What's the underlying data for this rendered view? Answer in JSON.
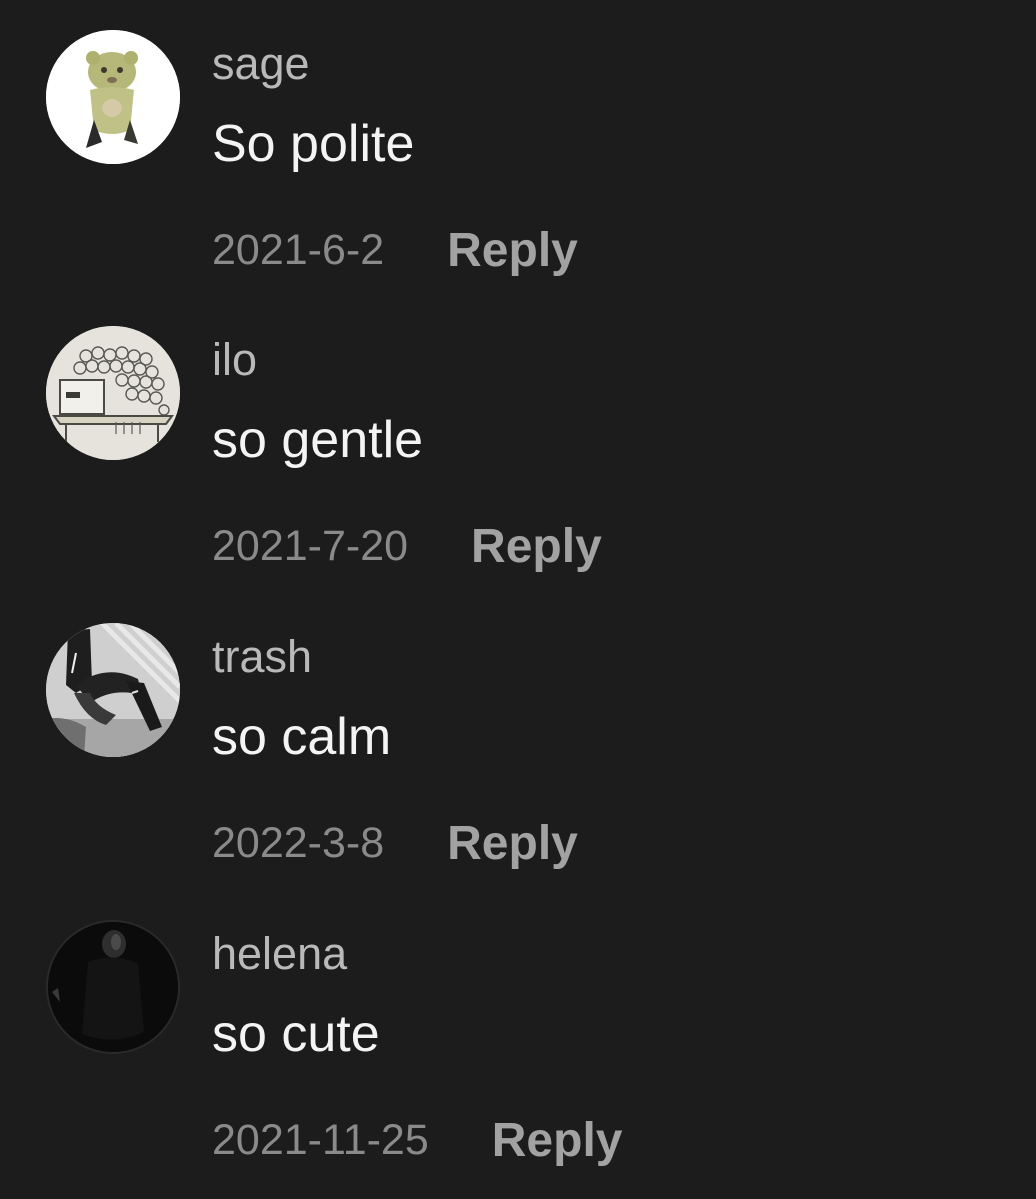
{
  "theme": {
    "background": "#1c1c1c",
    "username_color": "#b9b9b9",
    "text_color": "#f4f4f4",
    "date_color": "#8a8a8a",
    "reply_color": "#a2a2a2"
  },
  "comments": [
    {
      "username": "sage",
      "text": "So polite",
      "date": "2021-6-2",
      "reply_label": "Reply",
      "avatar": "green-plush-toy-avatar"
    },
    {
      "username": "ilo",
      "text": "so gentle",
      "date": "2021-7-20",
      "reply_label": "Reply",
      "avatar": "sketch-drawing-avatar"
    },
    {
      "username": "trash",
      "text": "so calm",
      "date": "2022-3-8",
      "reply_label": "Reply",
      "avatar": "seated-person-photo-avatar"
    },
    {
      "username": "helena",
      "text": "so cute",
      "date": "2021-11-25",
      "reply_label": "Reply",
      "avatar": "dark-portrait-avatar"
    }
  ]
}
